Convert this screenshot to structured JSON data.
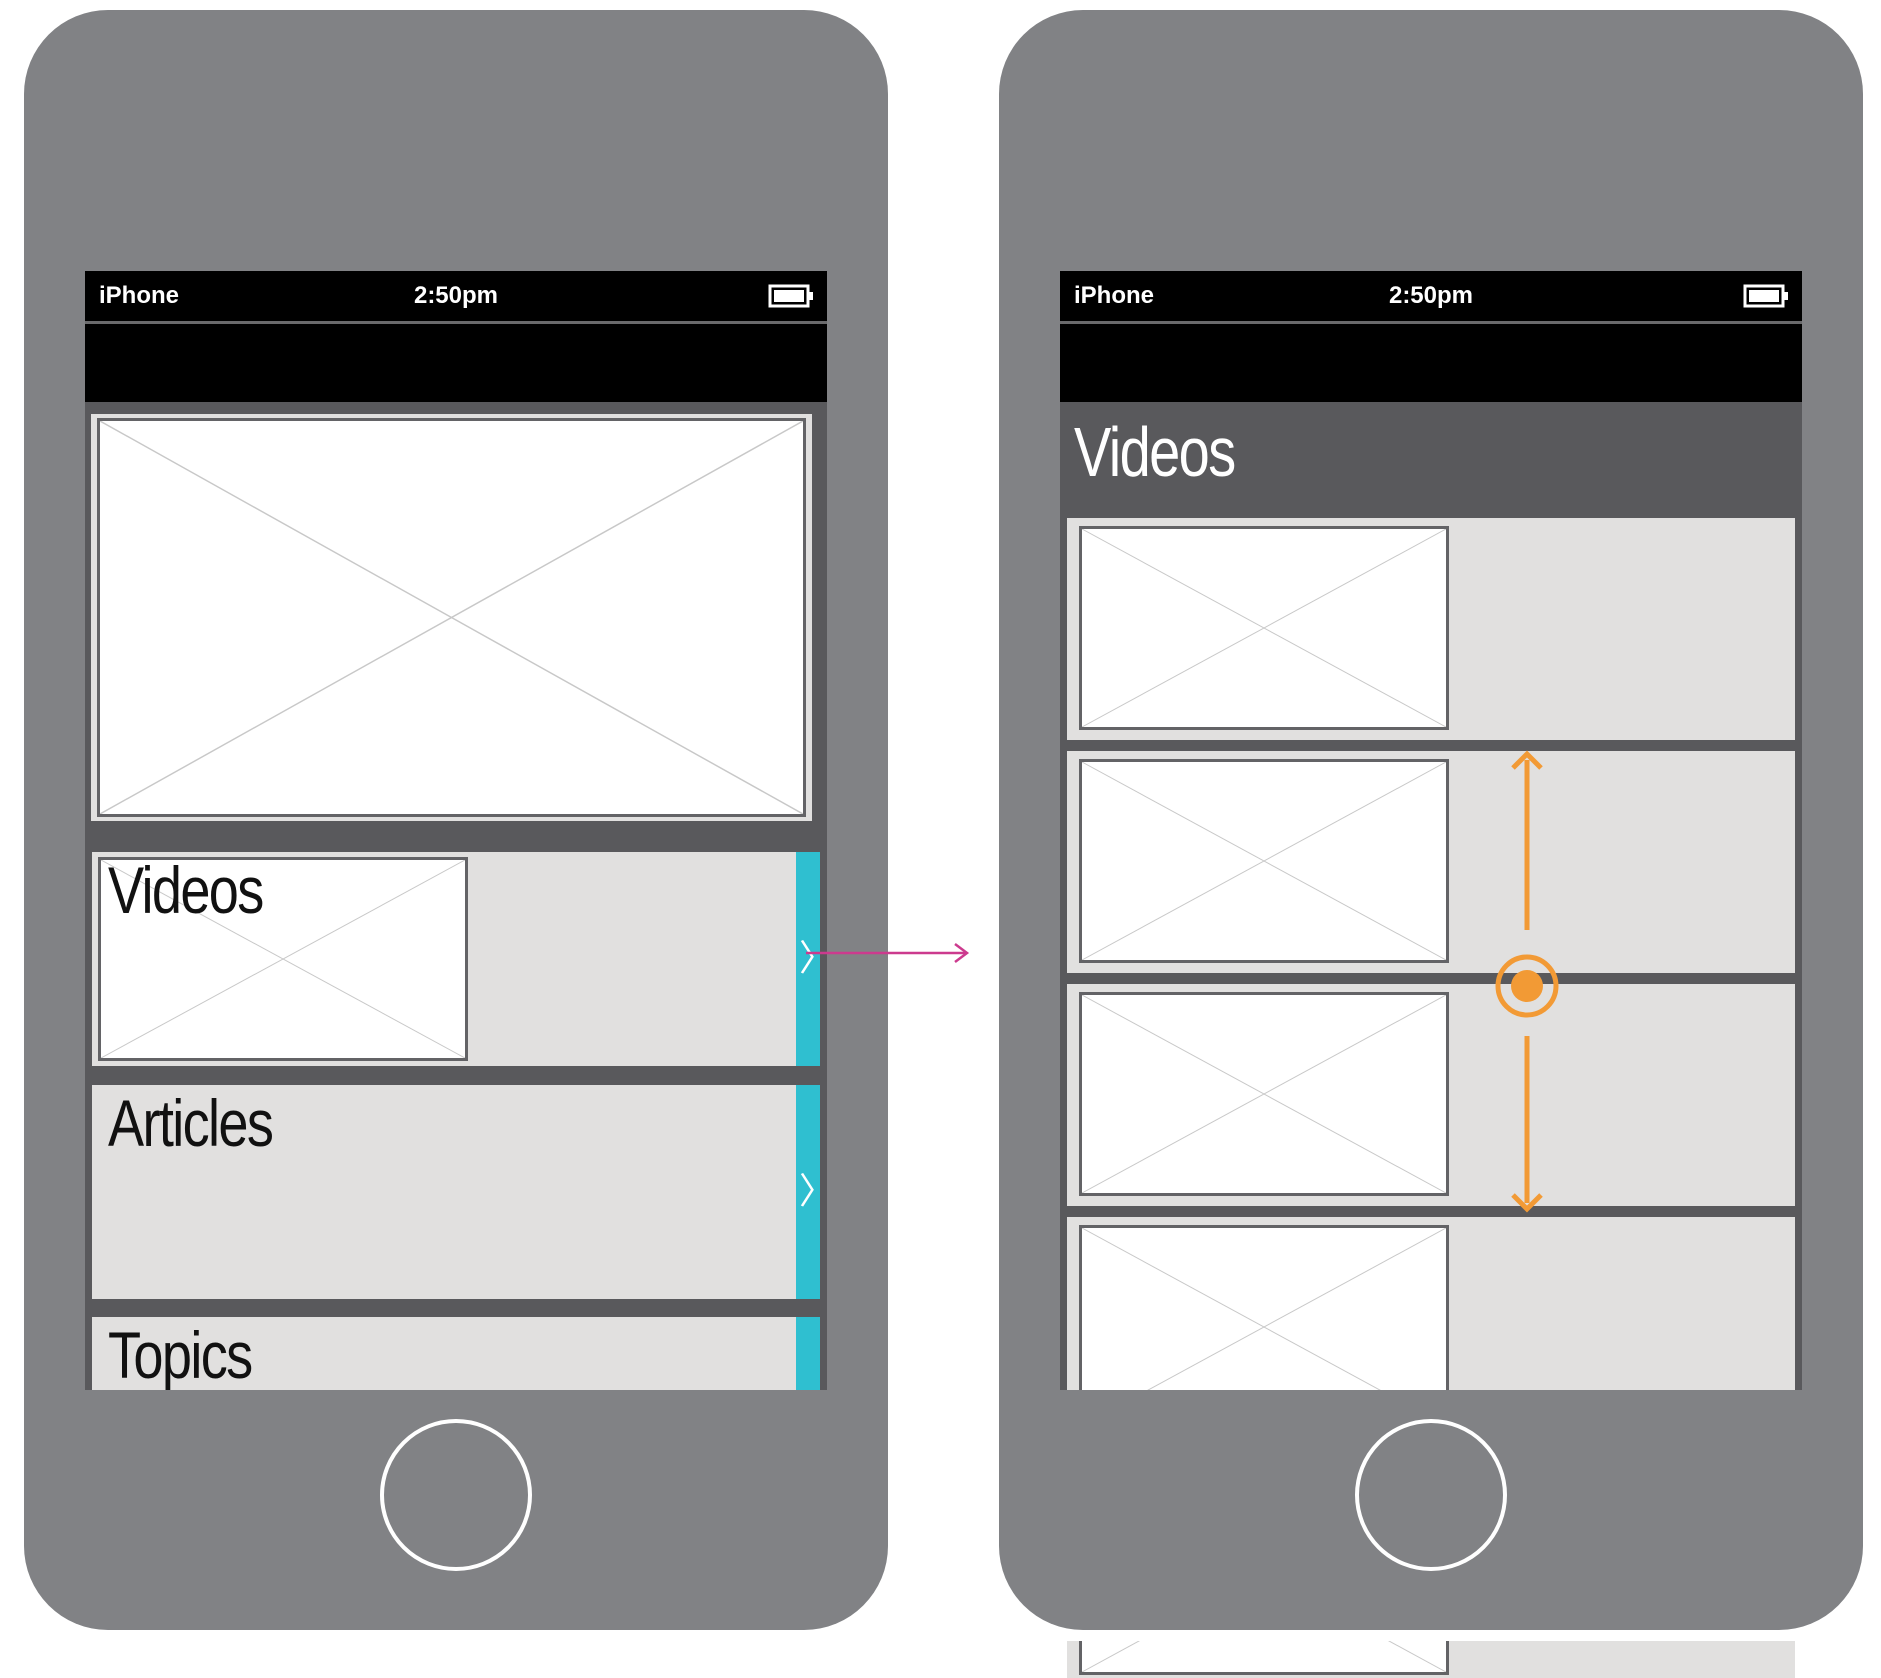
{
  "left_phone": {
    "status_bar": {
      "carrier": "iPhone",
      "time": "2:50pm",
      "battery_icon": "battery-icon"
    },
    "hero_image": "image-placeholder",
    "sections": [
      {
        "label": "Videos",
        "has_thumbnail": true,
        "chevron": "〉"
      },
      {
        "label": "Articles",
        "has_thumbnail": false,
        "chevron": "〉"
      },
      {
        "label": "Topics",
        "has_thumbnail": false,
        "chevron": ""
      }
    ],
    "accent_color": "#2fbfd0"
  },
  "transition_arrow": {
    "color": "#cc3a8e",
    "icon": "arrow-right-icon"
  },
  "right_phone": {
    "status_bar": {
      "carrier": "iPhone",
      "time": "2:50pm",
      "battery_icon": "battery-icon"
    },
    "section_title": "Videos",
    "rows": [
      "video-row",
      "video-row",
      "video-row",
      "video-row"
    ],
    "gesture": {
      "icon": "vertical-scroll-gesture-icon",
      "color": "#f29a35"
    }
  }
}
